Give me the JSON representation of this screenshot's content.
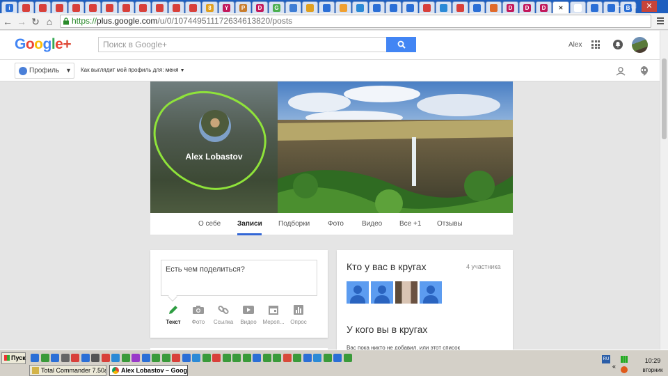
{
  "browser": {
    "url_scheme": "https://",
    "url_host": "plus.google.com",
    "url_path": "/u/0/107449511172634613820/posts",
    "tab_icon_colors": [
      "#2b6fd6",
      "#d8403a",
      "#d8403a",
      "#d8403a",
      "#d8403a",
      "#d8403a",
      "#d8403a",
      "#d8403a",
      "#d8403a",
      "#d8403a",
      "#d8403a",
      "#d8403a",
      "#e0a020",
      "#c2185b",
      "#c97d2d",
      "#c2185b",
      "#4caf50",
      "#3f7dd4",
      "#e0a020",
      "#2b6fd6",
      "#f0a030",
      "#2b8ad6",
      "#2b6fd6",
      "#2b6fd6",
      "#2b6fd6",
      "#d8403a",
      "#2b8ad6",
      "#d8403a",
      "#2b6fd6",
      "#e06a2a",
      "#c2185b",
      "#c2185b",
      "#c2185b",
      "#2e8b3a",
      "#ffffff",
      "#2b6fd6",
      "#2b6fd6",
      "#2b6fd6"
    ],
    "tab_glyphs": [
      "i",
      "",
      "",
      "",
      "",
      "",
      "",
      "",
      "",
      "",
      "",
      "",
      "8",
      "Y",
      "P",
      "D",
      "G",
      "",
      "",
      "",
      "",
      "",
      "",
      "",
      "",
      "",
      "",
      "",
      "",
      "",
      "D",
      "D",
      "D",
      "",
      "",
      "",
      "",
      "B"
    ]
  },
  "header": {
    "logo_text": "Google",
    "logo_plus": "+",
    "search_placeholder": "Поиск в Google+",
    "user_name": "Alex"
  },
  "subheader": {
    "profile_label": "Профиль",
    "view_as_label": "Как выглядит мой профиль для:",
    "view_as_value": "меня"
  },
  "profile": {
    "name": "Alex Lobastov",
    "tabs": [
      "О себе",
      "Записи",
      "Подборки",
      "Фото",
      "Видео",
      "Все +1",
      "Отзывы"
    ],
    "active_tab": "Записи"
  },
  "post": {
    "placeholder": "Есть чем поделиться?",
    "actions": [
      "Текст",
      "Фото",
      "Ссылка",
      "Видео",
      "Мероп...",
      "Опрос"
    ],
    "active_action": "Текст"
  },
  "circles": {
    "title": "Кто у вас в кругах",
    "count": "4 участника",
    "title2": "У кого вы в кругах",
    "note": "Вас пока никто не добавил, или этот список"
  },
  "taskbar": {
    "start_label": "Пуск",
    "tasks": [
      "Total Commander 7.50a ...",
      "Alex Lobastov – Goog..."
    ],
    "active_task": "Alex Lobastov – Goog...",
    "time": "10:29",
    "weekday": "вторник",
    "lang": "RU"
  },
  "colors": {
    "accent": "#4285f4",
    "tab_underline": "#3367d6",
    "annotation_circle": "#8fe33a",
    "url_https": "#2a8a2a"
  }
}
